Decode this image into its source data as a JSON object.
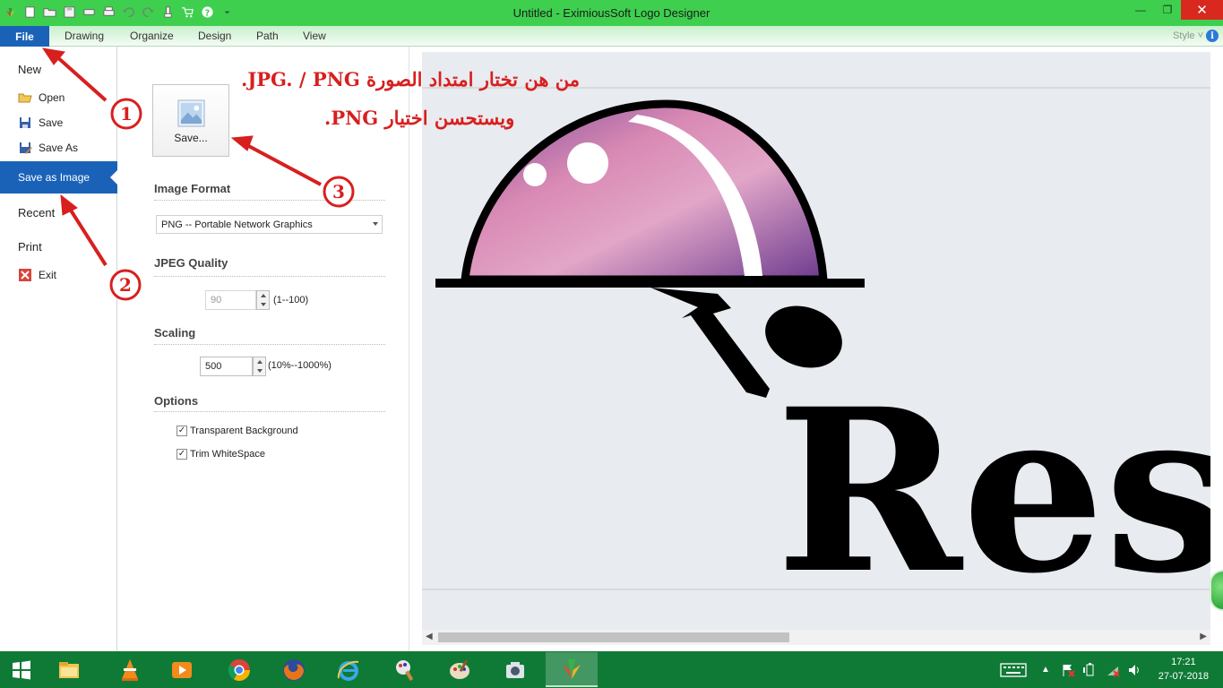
{
  "window": {
    "title": "Untitled - EximiousSoft Logo Designer",
    "minimize_icon": "minimize-icon",
    "restore_icon": "restore-icon",
    "close_icon": "close-icon"
  },
  "ribbon": {
    "tabs": [
      "File",
      "Drawing",
      "Organize",
      "Design",
      "Path",
      "View"
    ],
    "style_label": "Style"
  },
  "left_menu": {
    "new": "New",
    "open": "Open",
    "save": "Save",
    "save_as": "Save As",
    "save_as_image": "Save as Image",
    "recent": "Recent",
    "print": "Print",
    "exit": "Exit"
  },
  "panel": {
    "save_button": "Save...",
    "image_format": {
      "title": "Image Format",
      "selected": "PNG  -- Portable Network Graphics"
    },
    "jpeg_quality": {
      "title": "JPEG Quality",
      "value": "90",
      "range": "(1--100)"
    },
    "scaling": {
      "title": "Scaling",
      "value": "500",
      "range": "(10%--1000%)"
    },
    "options": {
      "title": "Options",
      "transparent_background": "Transparent Background",
      "trim_whitespace": "Trim WhiteSpace"
    }
  },
  "canvas": {
    "logo_text": "Res"
  },
  "annotations": {
    "line1": "من هن تختار امتداد الصورة JPG. / PNG.",
    "line2": "ويستحسن اختيار PNG.",
    "markers": [
      "1",
      "2",
      "3"
    ],
    "color": "#d81f1f"
  },
  "taskbar": {
    "apps": [
      "start-icon",
      "file-explorer-icon",
      "vlc-icon",
      "media-player-icon",
      "chrome-icon",
      "firefox-icon",
      "internet-explorer-icon",
      "paint-icon",
      "paint-palette-icon",
      "camera-icon",
      "logo-designer-icon"
    ],
    "clock": {
      "time": "17:21",
      "date": "27-07-2018"
    }
  },
  "colors": {
    "titlebar": "#3ecf4e",
    "file_tab": "#1a62b8",
    "taskbar": "#0f7a36"
  }
}
